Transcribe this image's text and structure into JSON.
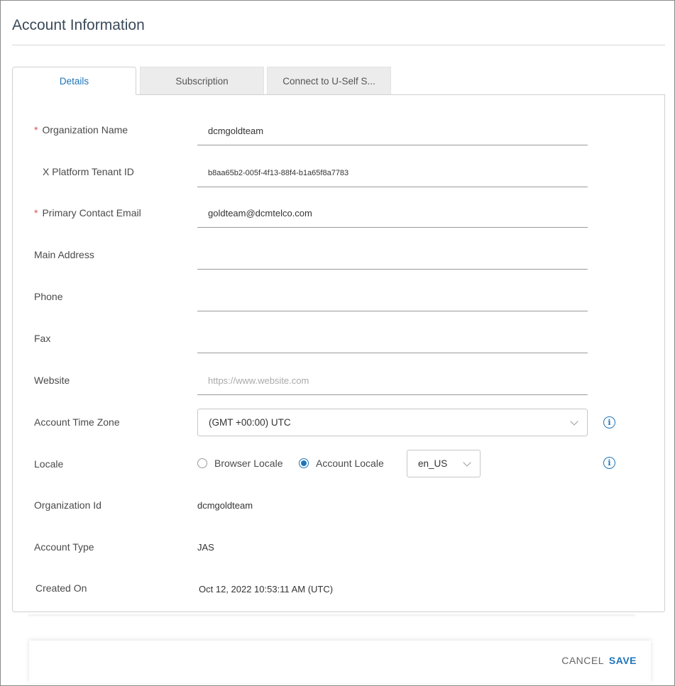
{
  "page": {
    "title": "Account Information"
  },
  "tabs": [
    {
      "label": "Details",
      "active": true
    },
    {
      "label": "Subscription",
      "active": false
    },
    {
      "label": "Connect to U-Self S...",
      "active": false
    }
  ],
  "form": {
    "organization_name": {
      "label": "Organization Name",
      "required": true,
      "value": "dcmgoldteam"
    },
    "tenant_id": {
      "label": "X Platform Tenant ID",
      "value": "b8aa65b2-005f-4f13-88f4-b1a65f8a7783"
    },
    "primary_email": {
      "label": "Primary Contact Email",
      "required": true,
      "value": "goldteam@dcmtelco.com"
    },
    "main_address": {
      "label": "Main Address",
      "value": ""
    },
    "phone": {
      "label": "Phone",
      "value": ""
    },
    "fax": {
      "label": "Fax",
      "value": ""
    },
    "website": {
      "label": "Website",
      "value": "",
      "placeholder": "https://www.website.com"
    },
    "time_zone": {
      "label": "Account Time Zone",
      "value": "(GMT +00:00) UTC"
    },
    "locale": {
      "label": "Locale",
      "browser_option": "Browser Locale",
      "account_option": "Account Locale",
      "selected": "account",
      "value": "en_US"
    },
    "organization_id": {
      "label": "Organization Id",
      "value": "dcmgoldteam"
    },
    "account_type": {
      "label": "Account Type",
      "value": "JAS"
    },
    "created_on": {
      "label": "Created On",
      "value": "Oct 12, 2022 10:53:11 AM (UTC)"
    },
    "required_marker": "*",
    "info_glyph": "i"
  },
  "footer": {
    "cancel_label": "CANCEL",
    "save_label": "SAVE"
  },
  "colors": {
    "accent": "#1f74b8",
    "required": "#d9534f"
  },
  "icons": {
    "info": "info-icon",
    "chevron": "chevron-down-icon"
  }
}
